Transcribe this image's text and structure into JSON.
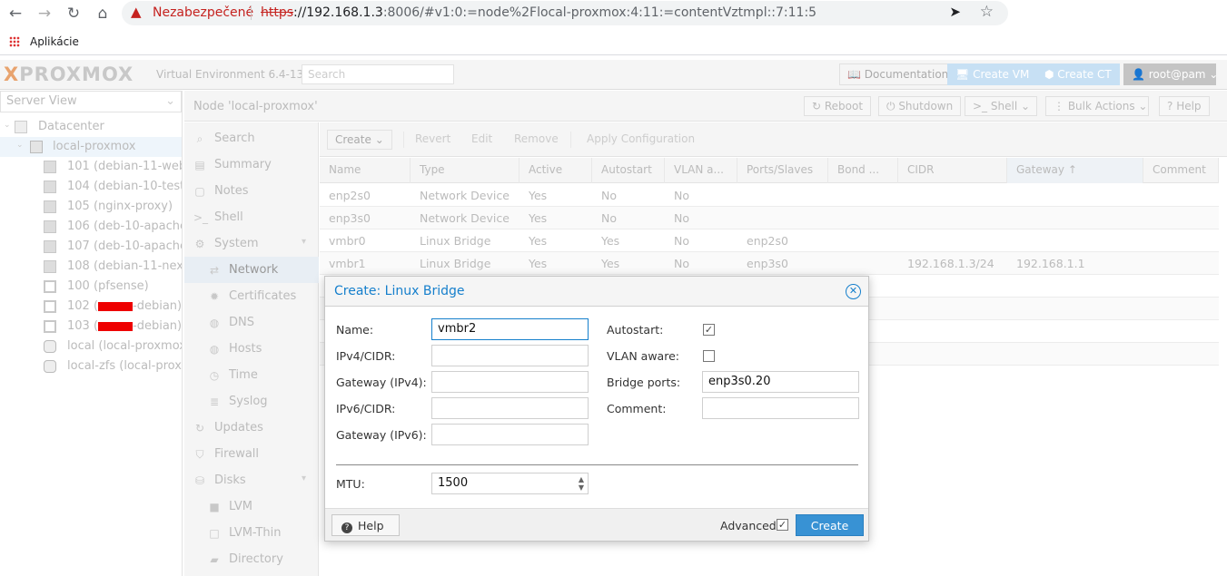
{
  "browser": {
    "security_label": "Nezabezpečené",
    "url_scheme": "https",
    "url_host": "://192.168.1.3",
    "url_rest": ":8006/#v1:0:=node%2Flocal-proxmox:4:11:=contentVztmpl::7:11:5",
    "bookmark_apps": "Aplikácie"
  },
  "header": {
    "logo_x": "X",
    "logo_text": "PROXMOX",
    "version": "Virtual Environment 6.4-13",
    "search_placeholder": "Search",
    "documentation": "Documentation",
    "create_vm": "Create VM",
    "create_ct": "Create CT",
    "user": "root@pam"
  },
  "tree": {
    "view": "Server View",
    "datacenter": "Datacenter",
    "node": "local-proxmox",
    "items": [
      {
        "label": "101 (debian-11-webs)",
        "type": "ct"
      },
      {
        "label": "104 (debian-10-test)",
        "type": "ct"
      },
      {
        "label": "105 (nginx-proxy)",
        "type": "ct"
      },
      {
        "label": "106 (deb-10-apache-1",
        "type": "ct"
      },
      {
        "label": "107 (deb-10-apache-2",
        "type": "ct"
      },
      {
        "label": "108 (debian-11-nextcl",
        "type": "ct"
      },
      {
        "label": "100 (pfsense)",
        "type": "vm"
      },
      {
        "label_prefix": "102 (",
        "label_suffix": "-debian)",
        "type": "vm"
      },
      {
        "label_prefix": "103 (",
        "label_suffix": "-debian)",
        "type": "vm"
      },
      {
        "label": "local (local-proxmox)",
        "type": "storage"
      },
      {
        "label": "local-zfs (local-proxm",
        "type": "storage"
      }
    ]
  },
  "center": {
    "title": "Node 'local-proxmox'",
    "reboot": "Reboot",
    "shutdown": "Shutdown",
    "shell": "Shell",
    "bulk_actions": "Bulk Actions",
    "help": "Help"
  },
  "menu": {
    "items": [
      {
        "label": "Search",
        "icon": "search-icon"
      },
      {
        "label": "Summary",
        "icon": "book-icon"
      },
      {
        "label": "Notes",
        "icon": "notes-icon"
      },
      {
        "label": "Shell",
        "icon": "terminal-icon"
      },
      {
        "label": "System",
        "icon": "gears-icon"
      },
      {
        "label": "Network",
        "icon": "exchange-icon"
      },
      {
        "label": "Certificates",
        "icon": "certificate-icon"
      },
      {
        "label": "DNS",
        "icon": "globe-icon"
      },
      {
        "label": "Hosts",
        "icon": "globe-icon"
      },
      {
        "label": "Time",
        "icon": "clock-icon"
      },
      {
        "label": "Syslog",
        "icon": "list-icon"
      },
      {
        "label": "Updates",
        "icon": "refresh-icon"
      },
      {
        "label": "Firewall",
        "icon": "shield-icon"
      },
      {
        "label": "Disks",
        "icon": "hdd-icon"
      },
      {
        "label": "LVM",
        "icon": "square-icon"
      },
      {
        "label": "LVM-Thin",
        "icon": "square-outline-icon"
      },
      {
        "label": "Directory",
        "icon": "folder-icon"
      }
    ]
  },
  "toolbar": {
    "create": "Create",
    "revert": "Revert",
    "edit": "Edit",
    "remove": "Remove",
    "apply": "Apply Configuration"
  },
  "grid": {
    "columns": [
      "Name",
      "Type",
      "Active",
      "Autostart",
      "VLAN a...",
      "Ports/Slaves",
      "Bond ...",
      "CIDR",
      "Gateway",
      "Comment"
    ],
    "rows": [
      [
        "enp2s0",
        "Network Device",
        "Yes",
        "No",
        "No",
        "",
        "",
        "",
        "",
        ""
      ],
      [
        "enp3s0",
        "Network Device",
        "Yes",
        "No",
        "No",
        "",
        "",
        "",
        "",
        ""
      ],
      [
        "vmbr0",
        "Linux Bridge",
        "Yes",
        "Yes",
        "No",
        "enp2s0",
        "",
        "",
        "",
        ""
      ],
      [
        "vmbr1",
        "Linux Bridge",
        "Yes",
        "Yes",
        "No",
        "enp3s0",
        "",
        "192.168.1.3/24",
        "192.168.1.1",
        ""
      ]
    ]
  },
  "dialog": {
    "title": "Create: Linux Bridge",
    "name_label": "Name:",
    "name_value": "vmbr2",
    "ipv4_label": "IPv4/CIDR:",
    "gw4_label": "Gateway (IPv4):",
    "ipv6_label": "IPv6/CIDR:",
    "gw6_label": "Gateway (IPv6):",
    "autostart_label": "Autostart:",
    "autostart_checked": true,
    "vlan_label": "VLAN aware:",
    "vlan_checked": false,
    "ports_label": "Bridge ports:",
    "ports_value": "enp3s0.20",
    "comment_label": "Comment:",
    "mtu_label": "MTU:",
    "mtu_value": "1500",
    "help": "Help",
    "advanced": "Advanced",
    "advanced_checked": true,
    "create": "Create"
  }
}
